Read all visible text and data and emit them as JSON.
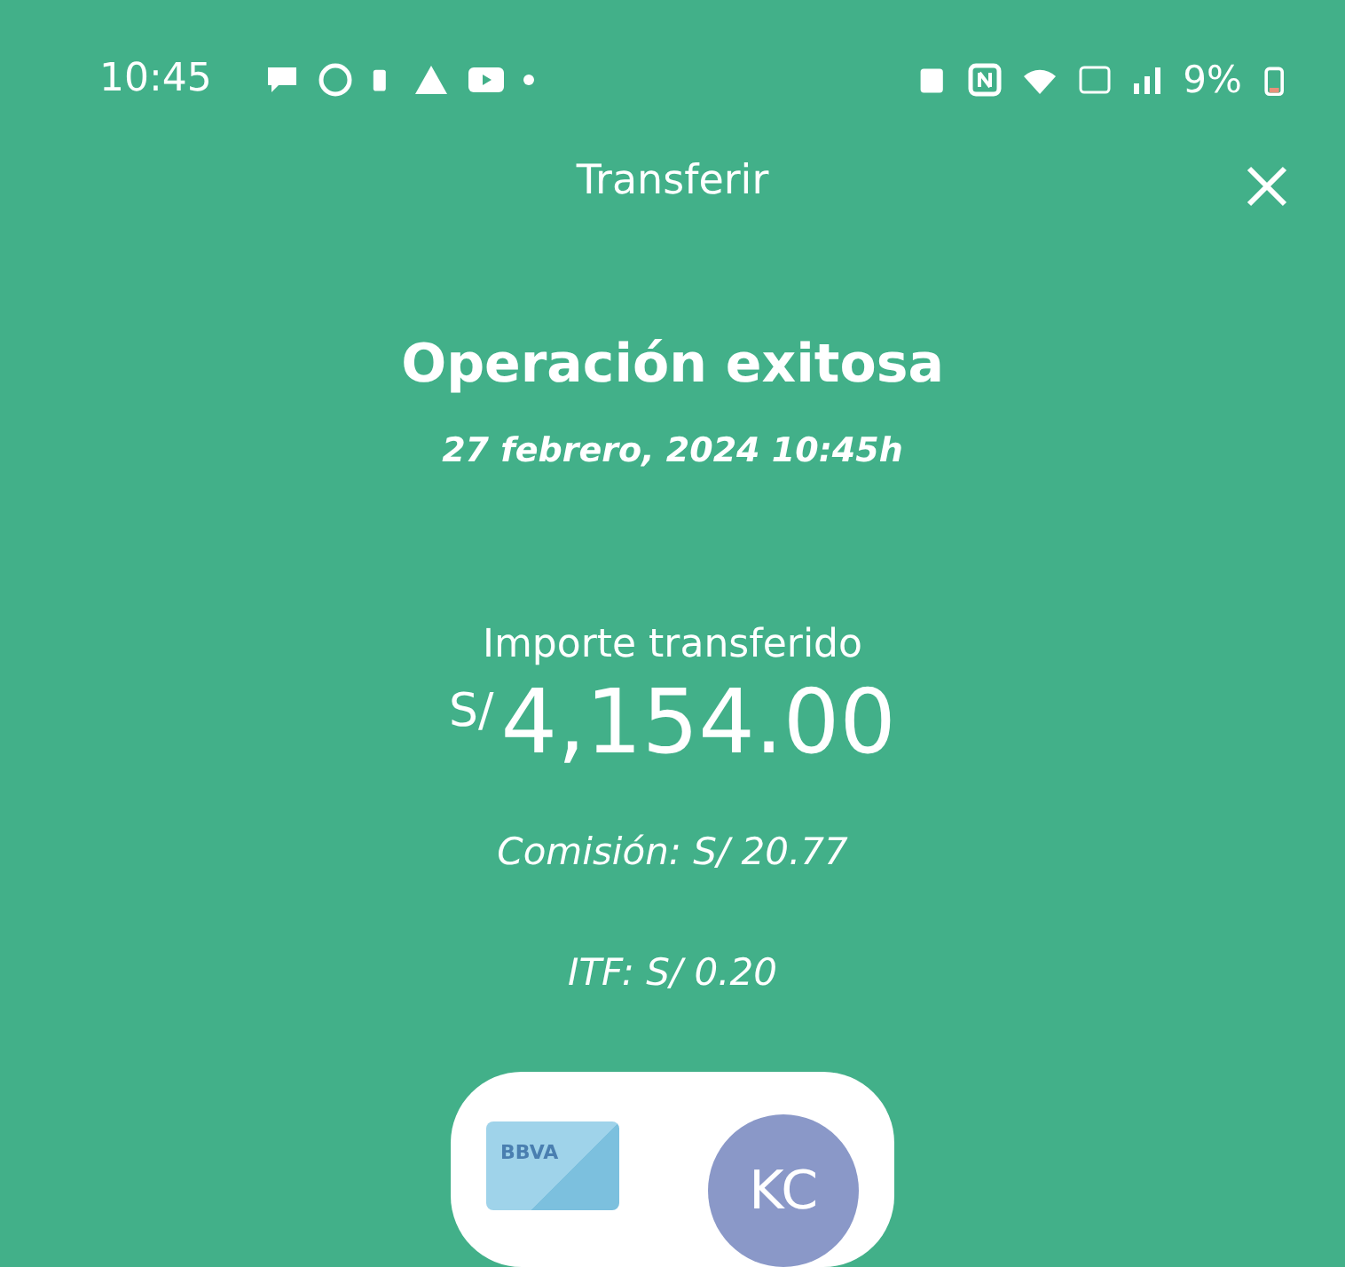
{
  "status_bar": {
    "time": "10:45",
    "battery": "9%"
  },
  "header": {
    "title": "Transferir"
  },
  "result": {
    "title": "Operación exitosa",
    "datetime": "27 febrero, 2024 10:45h"
  },
  "amount": {
    "label": "Importe transferido",
    "currency": "S/",
    "value": "4,154.00"
  },
  "fees": [
    {
      "text": "Comisión: S/ 20.77"
    },
    {
      "text": "ITF: S/ 0.20"
    }
  ],
  "accounts": {
    "card_brand": "BBVA",
    "initials": "KC"
  }
}
